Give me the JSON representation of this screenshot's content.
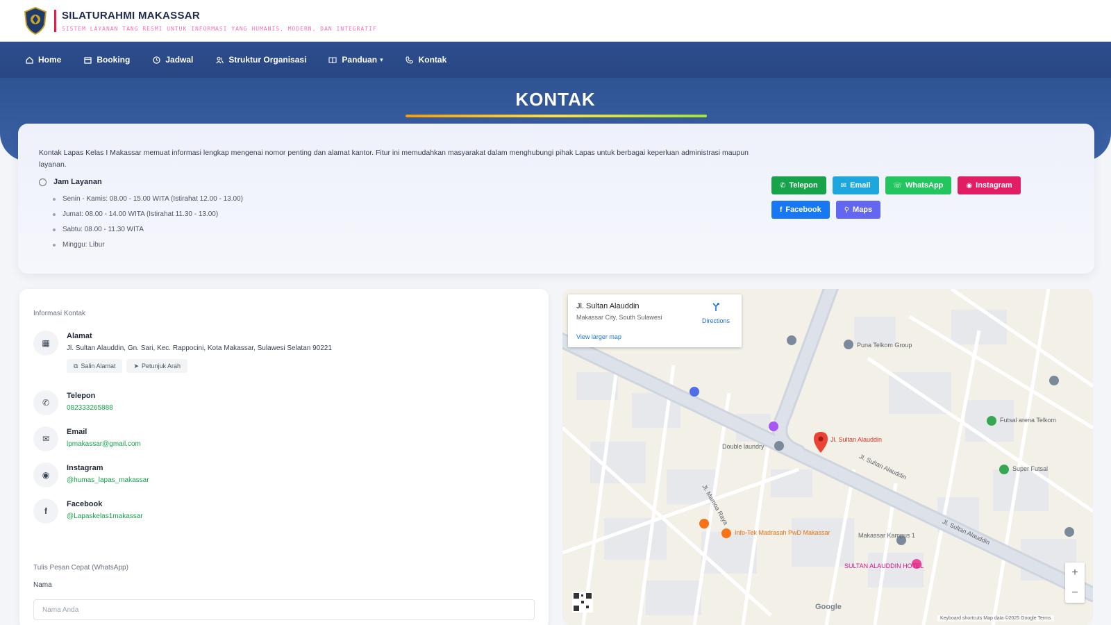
{
  "header": {
    "title": "SILATURAHMI MAKASSAR",
    "subtitle": "SISTEM LAYANAN TANG RESMI UNTUK INFORMASI YANG HUMANIS, MODERN, DAN INTEGRATIF"
  },
  "nav": {
    "items": [
      {
        "label": "Home",
        "icon": "home-icon"
      },
      {
        "label": "Booking",
        "icon": "calendar-icon"
      },
      {
        "label": "Jadwal",
        "icon": "clock-icon"
      },
      {
        "label": "Struktur Organisasi",
        "icon": "users-icon"
      },
      {
        "label": "Panduan",
        "icon": "book-icon"
      },
      {
        "label": "Kontak",
        "icon": "phone-icon"
      }
    ]
  },
  "page": {
    "title": "KONTAK"
  },
  "intro": {
    "text": "Kontak Lapas Kelas I Makassar memuat informasi lengkap mengenai nomor penting dan alamat kantor. Fitur ini memudahkan masyarakat dalam menghubungi pihak Lapas untuk berbagai keperluan administrasi maupun layanan.",
    "hours_title": "Jam Layanan",
    "hours": [
      "Senin - Kamis: 08.00 - 15.00 WITA (Istirahat 12.00 - 13.00)",
      "Jumat: 08.00 - 14.00 WITA (Istirahat 11.30 - 13.00)",
      "Sabtu: 08.00 - 11.30 WITA",
      "Minggu: Libur"
    ],
    "buttons": [
      {
        "label": "Telepon",
        "icon": "phone-icon",
        "color": "#16a34a"
      },
      {
        "label": "Email",
        "icon": "mail-icon",
        "color": "#1ea7dd"
      },
      {
        "label": "WhatsApp",
        "icon": "whatsapp-icon",
        "color": "#22c55e"
      },
      {
        "label": "Instagram",
        "icon": "instagram-icon",
        "color": "#e11d64"
      },
      {
        "label": "Facebook",
        "icon": "facebook-icon",
        "color": "#1877f2"
      },
      {
        "label": "Maps",
        "icon": "map-pin-icon",
        "color": "#6366f1"
      }
    ]
  },
  "contact": {
    "section_title": "Informasi Kontak",
    "address": {
      "title": "Alamat",
      "value": "Jl. Sultan Alauddin, Gn. Sari, Kec. Rappocini, Kota Makassar, Sulawesi Selatan 90221",
      "copy_label": "Salin Alamat",
      "directions_label": "Petunjuk Arah"
    },
    "phone": {
      "title": "Telepon",
      "value": "082333265888"
    },
    "email": {
      "title": "Email",
      "value": "lpmakassar@gmail.com"
    },
    "instagram": {
      "title": "Instagram",
      "value": "@humas_lapas_makassar"
    },
    "facebook": {
      "title": "Facebook",
      "value": "@Lapaskelas1makassar"
    },
    "form": {
      "section_title": "Tulis Pesan Cepat (WhatsApp)",
      "name_label": "Nama",
      "name_placeholder": "Nama Anda"
    }
  },
  "map": {
    "popup_title": "Jl. Sultan Alauddin",
    "popup_sub": "Makassar City, South Sulawesi",
    "directions": "Directions",
    "larger_map": "View larger map",
    "pin_label": "Jl. Sultan Alauddin",
    "places": [
      "Puna Telkom Group",
      "Futsal arena Telkom",
      "Super Futsal",
      "Double laundry",
      "Info-Tek Madrasah PwD Makassar",
      "Makassar Kampus 1",
      "SULTAN ALAUDDIN HOTEL",
      "Jl. Sultan Alauddin",
      "Jl. Mamoa Raya",
      "Jl. Sultan Alauddin"
    ],
    "footer": "Keyboard shortcuts   Map data ©2025 Google   Terms",
    "google": "Google"
  }
}
